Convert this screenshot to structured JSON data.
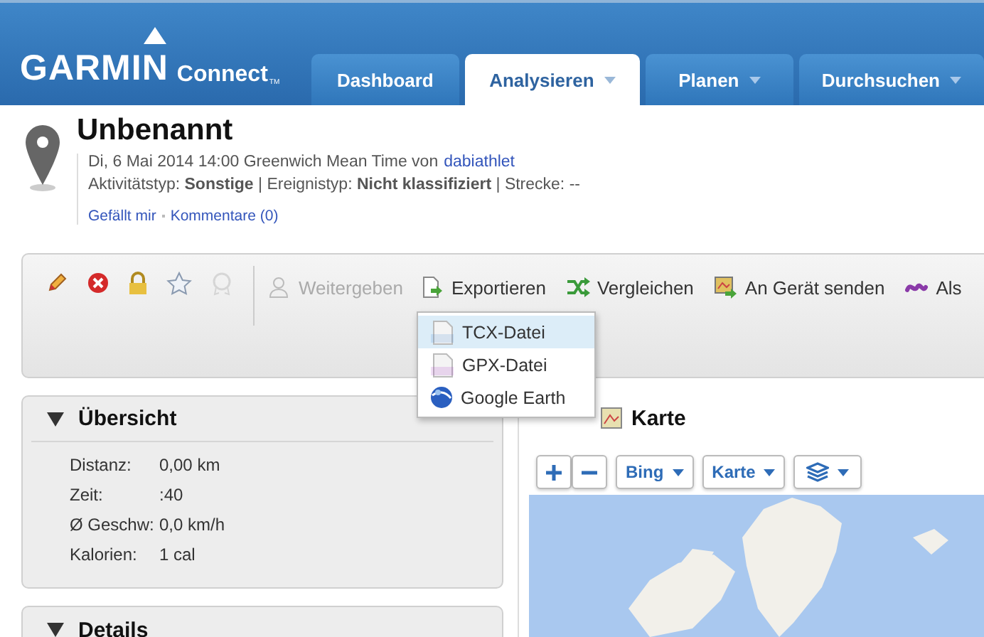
{
  "header": {
    "logo": "GARMIN",
    "logo_sub": "Connect",
    "logo_tm": "TM",
    "tabs": [
      {
        "label": "Dashboard",
        "selected": false,
        "has_menu": false
      },
      {
        "label": "Analysieren",
        "selected": true,
        "has_menu": true
      },
      {
        "label": "Planen",
        "selected": false,
        "has_menu": true
      },
      {
        "label": "Durchsuchen",
        "selected": false,
        "has_menu": true
      }
    ]
  },
  "activity": {
    "title": "Unbenannt",
    "date": "Di, 6 Mai 2014 14:00 Greenwich Mean Time von",
    "user": "dabiathlet",
    "meta": "Aktivitätstyp: **Sonstige** | Ereignistyp: **Nicht klassifiziert** | Strecke: --",
    "links": [
      "Gefällt mir",
      "Kommentare (0)"
    ]
  },
  "toolbar": {
    "icons": [
      {
        "kind": "edit",
        "disabled": false
      },
      {
        "kind": "delete",
        "disabled": false
      },
      {
        "kind": "lock",
        "disabled": false
      },
      {
        "kind": "star",
        "disabled": false
      },
      {
        "kind": "badge",
        "disabled": true
      }
    ],
    "actions": [
      {
        "kind": "share",
        "label": "Weitergeben",
        "disabled": true
      },
      {
        "kind": "export",
        "label": "Exportieren",
        "disabled": false
      },
      {
        "kind": "compare",
        "label": "Vergleichen",
        "disabled": false
      },
      {
        "kind": "device",
        "label": "An Gerät senden",
        "disabled": false
      },
      {
        "kind": "course",
        "label": "Als",
        "disabled": false
      }
    ]
  },
  "export_menu": [
    {
      "kind": "tcx",
      "label": "TCX-Datei",
      "selected": true
    },
    {
      "kind": "gpx",
      "label": "GPX-Datei",
      "selected": false
    },
    {
      "kind": "earth",
      "label": "Google Earth",
      "selected": false
    }
  ],
  "overview": {
    "title": "Übersicht",
    "expanded": true,
    "rows": [
      {
        "label": "Distanz:",
        "value": "0,00 km"
      },
      {
        "label": "Zeit:",
        "value": ":40"
      },
      {
        "label": "Ø Geschw:",
        "value": "0,0 km/h"
      },
      {
        "label": "Kalorien:",
        "value": "1 cal"
      }
    ]
  },
  "details": {
    "title": "Details",
    "expanded": true
  },
  "map": {
    "title": "Karte",
    "controls": [
      {
        "kind": "zoom_in"
      },
      {
        "kind": "zoom_out"
      },
      {
        "kind": "menu",
        "label": "Bing"
      },
      {
        "kind": "menu",
        "label": "Karte"
      },
      {
        "kind": "layers"
      }
    ]
  }
}
